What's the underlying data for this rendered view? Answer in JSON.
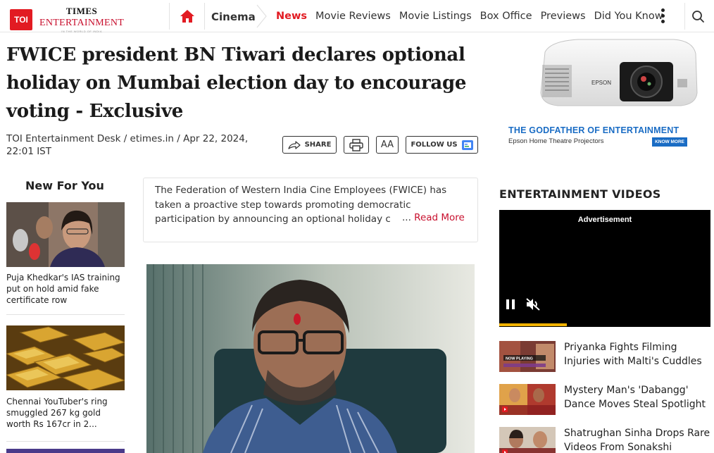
{
  "logo": {
    "toi": "TOI",
    "times": "TIMES",
    "entertainment": "ENTERTAINMENT",
    "tagline": "IN THE WORLD OF INDIA"
  },
  "nav": {
    "section": "Cinema",
    "links": [
      "News",
      "Movie Reviews",
      "Movie Listings",
      "Box Office",
      "Previews",
      "Did You Know"
    ],
    "active": "News"
  },
  "article": {
    "headline": "FWICE president BN Tiwari declares optional holiday on Mumbai election day to encourage voting - Exclusive",
    "byline": "TOI Entertainment Desk / etimes.in / Apr 22, 2024, 22:01 IST",
    "share_label": "SHARE",
    "font_label": "AA",
    "follow_label": "FOLLOW US",
    "summary": "The Federation of Western India Cine Employees (FWICE) has taken a proactive step towards promoting democratic participation by announcing an optional holiday c",
    "ellipsis": "...",
    "read_more": "Read More"
  },
  "ad": {
    "title": "THE GODFATHER OF ENTERTAINMENT",
    "subtitle": "Epson Home Theatre Projectors",
    "button": "KNOW MORE",
    "brand": "EPSON"
  },
  "sidebar": {
    "title": "New For You",
    "items": [
      {
        "caption": "Puja Khedkar's IAS training put on hold amid fake certificate row"
      },
      {
        "caption": "Chennai YouTuber's ring smuggled 267 kg gold worth Rs 167cr in 2..."
      }
    ]
  },
  "videos": {
    "title": "ENTERTAINMENT VIDEOS",
    "ad_label": "Advertisement",
    "progress": 0.32,
    "items": [
      {
        "title": "Priyanka Fights Filming Injuries with Malti's Cuddles",
        "thumb_text": "NOW PLAYING"
      },
      {
        "title": "Mystery Man's 'Dabangg' Dance Moves Steal Spotlight"
      },
      {
        "title": "Shatrughan Sinha Drops Rare Videos From Sonakshi"
      }
    ]
  },
  "colors": {
    "brand_red": "#e21b22",
    "accent_blue": "#1a6cc4",
    "read_more": "#c8102e",
    "progress": "#f2b300"
  }
}
